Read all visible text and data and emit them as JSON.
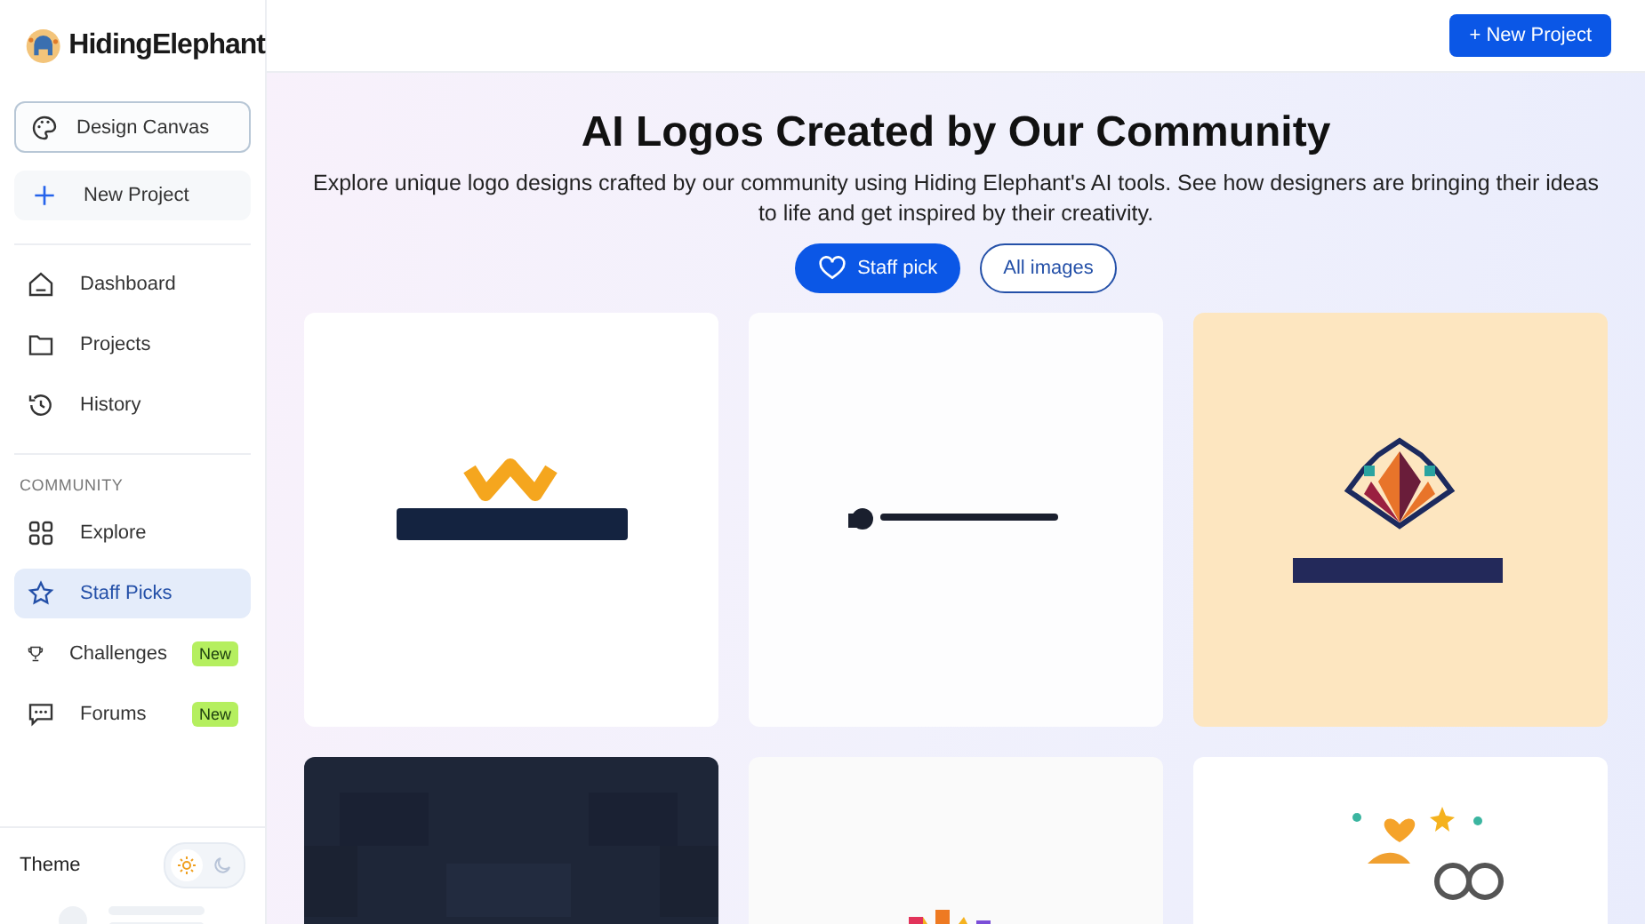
{
  "brand": {
    "name": "HidingElephant"
  },
  "sidebar": {
    "actions": [
      {
        "label": "Design Canvas",
        "kind": "outlined"
      },
      {
        "label": "New Project",
        "kind": "filled"
      }
    ],
    "nav": [
      {
        "label": "Dashboard",
        "selected": false
      },
      {
        "label": "Projects",
        "selected": false
      },
      {
        "label": "History",
        "selected": false
      }
    ],
    "community_heading": "COMMUNITY",
    "community": [
      {
        "label": "Explore",
        "selected": false
      },
      {
        "label": "Staff Picks",
        "selected": true
      },
      {
        "label": "Challenges",
        "selected": false,
        "badge": "New"
      },
      {
        "label": "Forums",
        "selected": false,
        "badge": "New"
      }
    ],
    "theme": {
      "label": "Theme",
      "options": [
        {
          "selected": true
        },
        {
          "selected": false
        }
      ]
    }
  },
  "header": {
    "new_project_button": "+ New Project"
  },
  "hero": {
    "title": "AI Logos Created by Our Community",
    "subtitle": "Explore unique logo designs crafted by our community using Hiding Elephant's AI tools. See how designers are bringing their ideas to life and get inspired by their creativity."
  },
  "filters": [
    {
      "label": "Staff pick",
      "selected": true
    },
    {
      "label": "All images",
      "selected": false
    }
  ]
}
